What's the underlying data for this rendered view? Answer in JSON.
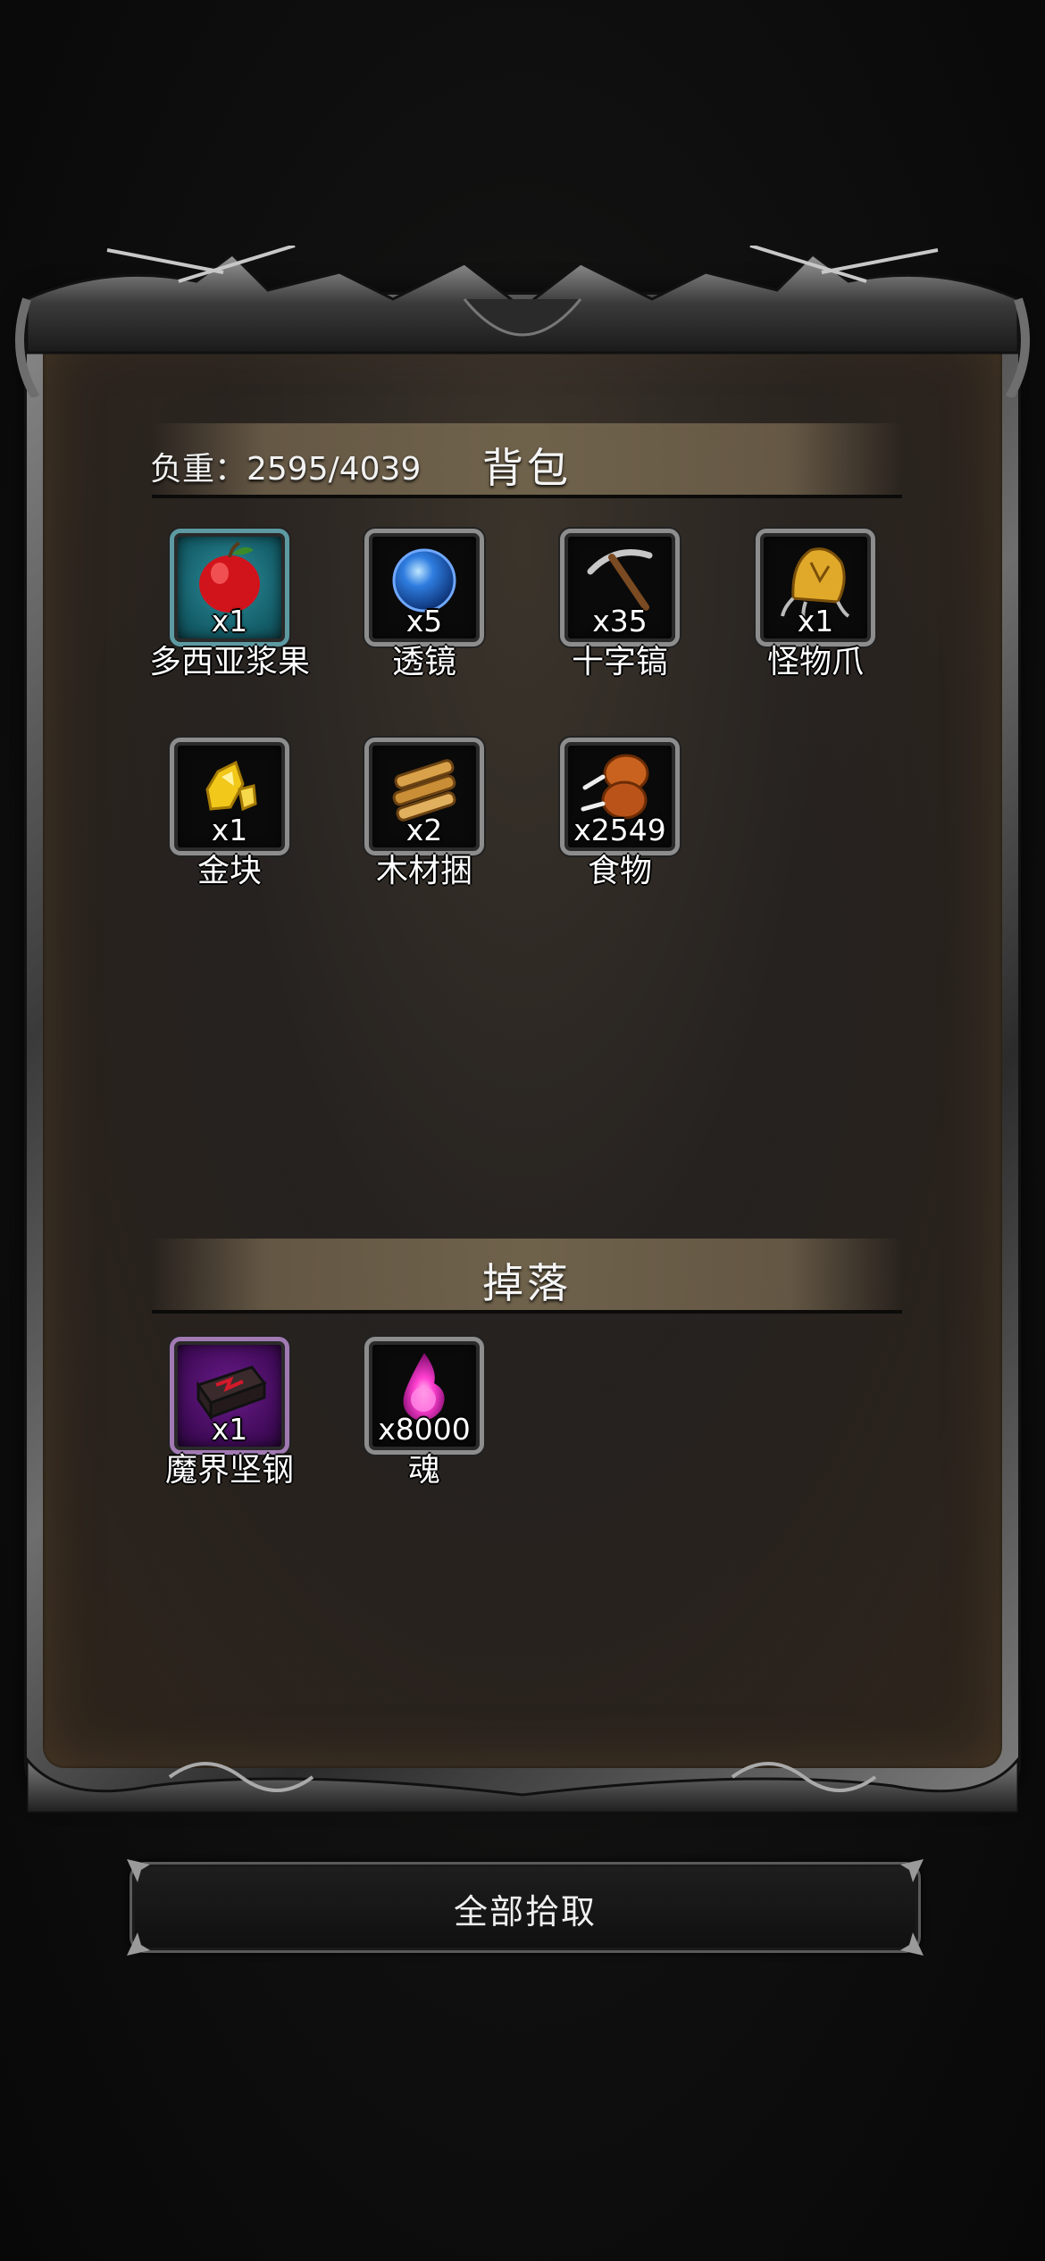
{
  "backpack": {
    "title": "背包",
    "weight_text": "负重：2595/4039",
    "items": [
      {
        "name": "多西亚浆果",
        "count": "x1",
        "icon": "apple-icon"
      },
      {
        "name": "透镜",
        "count": "x5",
        "icon": "blue-orb-icon"
      },
      {
        "name": "十字镐",
        "count": "x35",
        "icon": "pickaxe-icon"
      },
      {
        "name": "怪物爪",
        "count": "x1",
        "icon": "monster-claw-icon"
      },
      {
        "name": "金块",
        "count": "x1",
        "icon": "gold-nugget-icon"
      },
      {
        "name": "木材捆",
        "count": "x2",
        "icon": "wood-bundle-icon"
      },
      {
        "name": "食物",
        "count": "x2549",
        "icon": "meat-icon"
      }
    ]
  },
  "drops": {
    "title": "掉落",
    "items": [
      {
        "name": "魔界坚钢",
        "count": "x1",
        "icon": "demon-steel-ingot-icon"
      },
      {
        "name": "魂",
        "count": "x8000",
        "icon": "soul-flame-icon"
      }
    ]
  },
  "actions": {
    "pickup_all_label": "全部拾取"
  },
  "colors": {
    "rare_slot_cyan": "#2c8e9b",
    "epic_slot_purple": "#6a1b8a",
    "header_band": "#6f624b"
  }
}
